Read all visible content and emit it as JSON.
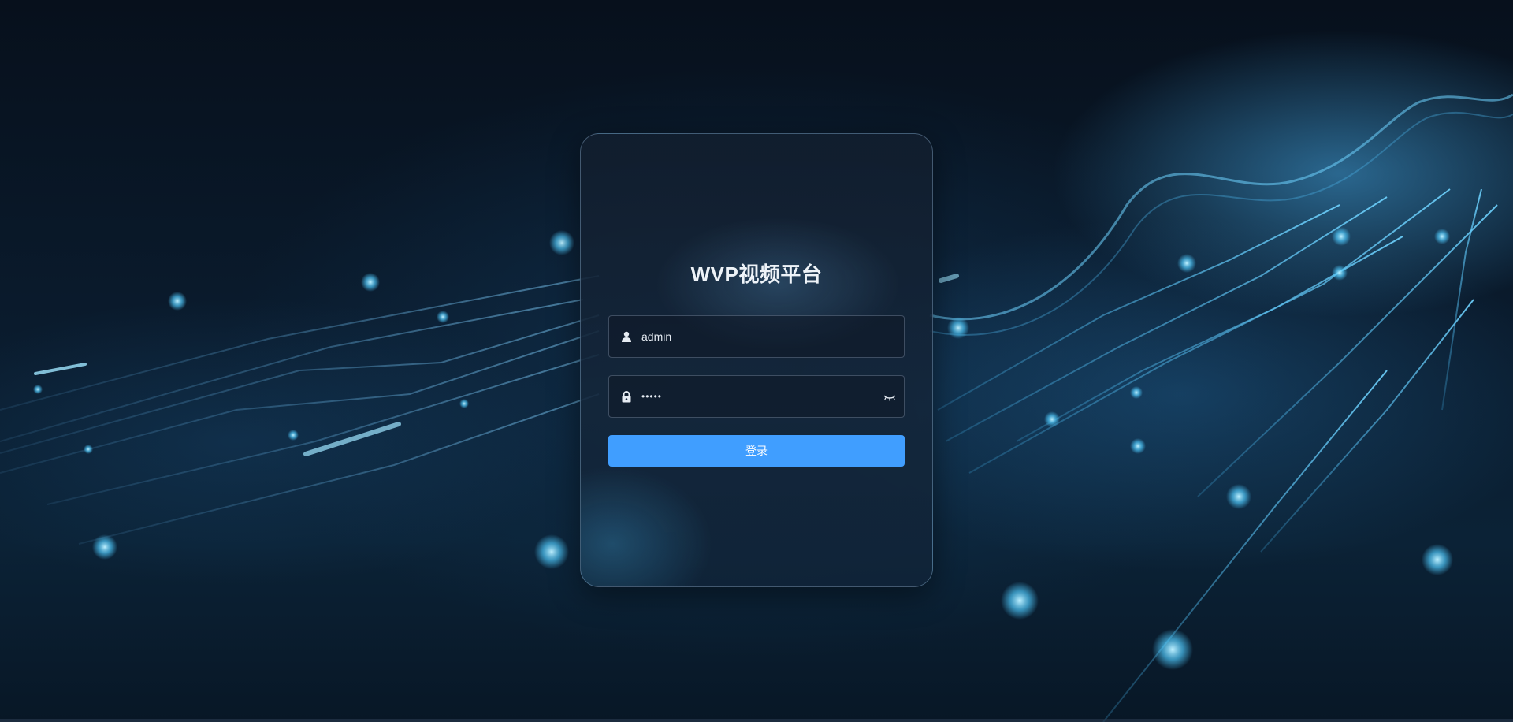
{
  "login": {
    "title": "WVP视频平台",
    "username": {
      "value": "admin",
      "icon": "user-icon"
    },
    "password": {
      "value": "•••••",
      "icon": "lock-icon",
      "toggle_icon": "eye-closed-icon"
    },
    "submit_label": "登录"
  },
  "colors": {
    "primary": "#409eff",
    "card_border": "#a0c8eb",
    "title": "#eef3f8"
  }
}
